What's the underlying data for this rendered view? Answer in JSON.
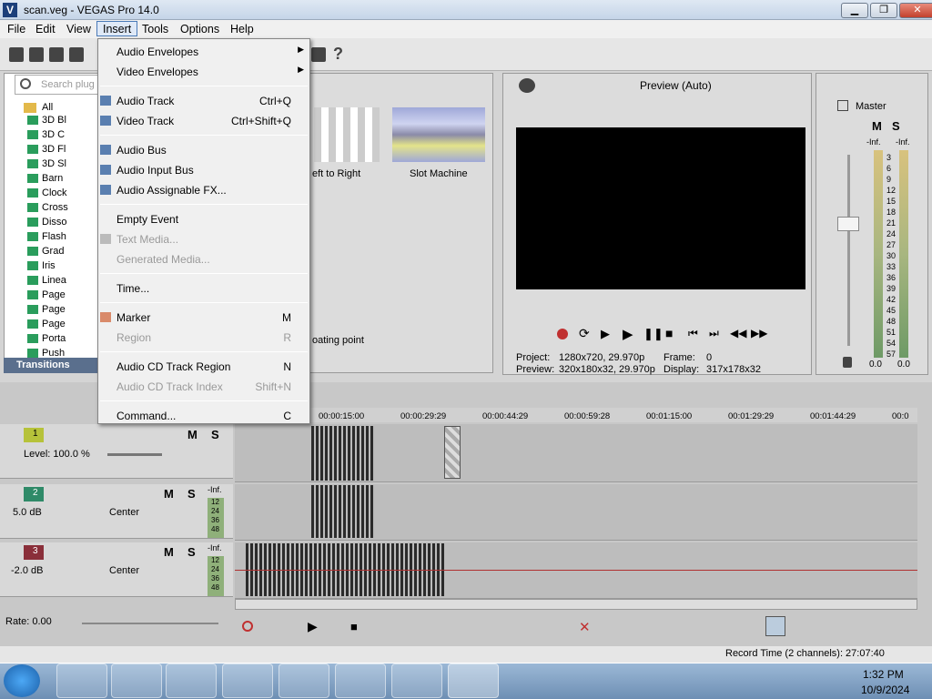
{
  "window": {
    "title": "scan.veg - VEGAS Pro 14.0",
    "minimize": "▁",
    "maximize": "❐",
    "close": "✕"
  },
  "menubar": [
    "File",
    "Edit",
    "View",
    "Insert",
    "Tools",
    "Options",
    "Help"
  ],
  "explorer": {
    "search_placeholder": "Search plug",
    "tree_root": "All",
    "tree_items": [
      "3D Bl",
      "3D C",
      "3D Fl",
      "3D Sl",
      "Barn",
      "Clock",
      "Cross",
      "Disso",
      "Flash",
      "Grad",
      "Iris",
      "Linea",
      "Page",
      "Page",
      "Page",
      "Porta",
      "Push"
    ],
    "tab_label": "Transitions"
  },
  "transitions": {
    "items": [
      {
        "label": "eft to Right"
      },
      {
        "label": "Slot Machine"
      }
    ],
    "footer": "oating point"
  },
  "preview": {
    "mode": "Preview (Auto)",
    "project_label": "Project:",
    "project_value": "1280x720, 29.970p",
    "preview_label": "Preview:",
    "preview_value": "320x180x32, 29.970p",
    "frame_label": "Frame:",
    "frame_value": "0",
    "display_label": "Display:",
    "display_value": "317x178x32"
  },
  "mixer": {
    "title": "Master",
    "left_label": "-Inf.",
    "right_label": "-Inf.",
    "scale": [
      "3",
      "6",
      "9",
      "12",
      "15",
      "18",
      "21",
      "24",
      "27",
      "30",
      "33",
      "36",
      "39",
      "42",
      "45",
      "48",
      "51",
      "54",
      "57"
    ],
    "left_value": "0.0",
    "right_value": "0.0",
    "m_label": "M",
    "s_label": "S"
  },
  "timeline": {
    "ruler": [
      "00:00:15:00",
      "00:00:29:29",
      "00:00:44:29",
      "00:00:59:28",
      "00:01:15:00",
      "00:01:29:29",
      "00:01:44:29",
      "00:0"
    ],
    "tracks": [
      {
        "num": "1",
        "level": "Level: 100.0 %",
        "m": "M",
        "s": "S"
      },
      {
        "num": "2",
        "vol": "5.0 dB",
        "pan": "Center",
        "m": "M",
        "s": "S",
        "inf": "-Inf.",
        "meter": [
          "12",
          "24",
          "36",
          "48"
        ]
      },
      {
        "num": "3",
        "vol": "-2.0 dB",
        "pan": "Center",
        "m": "M",
        "s": "S",
        "inf": "-Inf.",
        "meter": [
          "12",
          "24",
          "36",
          "48"
        ]
      }
    ],
    "rate": "Rate: 0.00"
  },
  "status": {
    "record_time": "Record Time (2 channels): 27:07:40"
  },
  "taskbar": {
    "time": "1:32 PM",
    "date": "10/9/2024"
  },
  "insert_menu": [
    {
      "label": "Audio Envelopes",
      "submenu": true
    },
    {
      "label": "Video Envelopes",
      "submenu": true
    },
    {
      "sep": true
    },
    {
      "label": "Audio Track",
      "shortcut": "Ctrl+Q",
      "icon": "audio-track-icon"
    },
    {
      "label": "Video Track",
      "shortcut": "Ctrl+Shift+Q",
      "icon": "video-track-icon"
    },
    {
      "sep": true
    },
    {
      "label": "Audio Bus",
      "icon": "audio-bus-icon"
    },
    {
      "label": "Audio Input Bus",
      "icon": "audio-input-bus-icon"
    },
    {
      "label": "Audio Assignable FX...",
      "icon": "assignable-fx-icon"
    },
    {
      "sep": true
    },
    {
      "label": "Empty Event"
    },
    {
      "label": "Text Media...",
      "disabled": true,
      "icon": "text-media-icon"
    },
    {
      "label": "Generated Media...",
      "disabled": true
    },
    {
      "sep": true
    },
    {
      "label": "Time..."
    },
    {
      "sep": true
    },
    {
      "label": "Marker",
      "shortcut": "M",
      "icon": "marker-icon"
    },
    {
      "label": "Region",
      "shortcut": "R",
      "disabled": true
    },
    {
      "sep": true
    },
    {
      "label": "Audio CD Track Region",
      "shortcut": "N"
    },
    {
      "label": "Audio CD Track Index",
      "shortcut": "Shift+N",
      "disabled": true
    },
    {
      "sep": true
    },
    {
      "label": "Command...",
      "shortcut": "C"
    }
  ]
}
